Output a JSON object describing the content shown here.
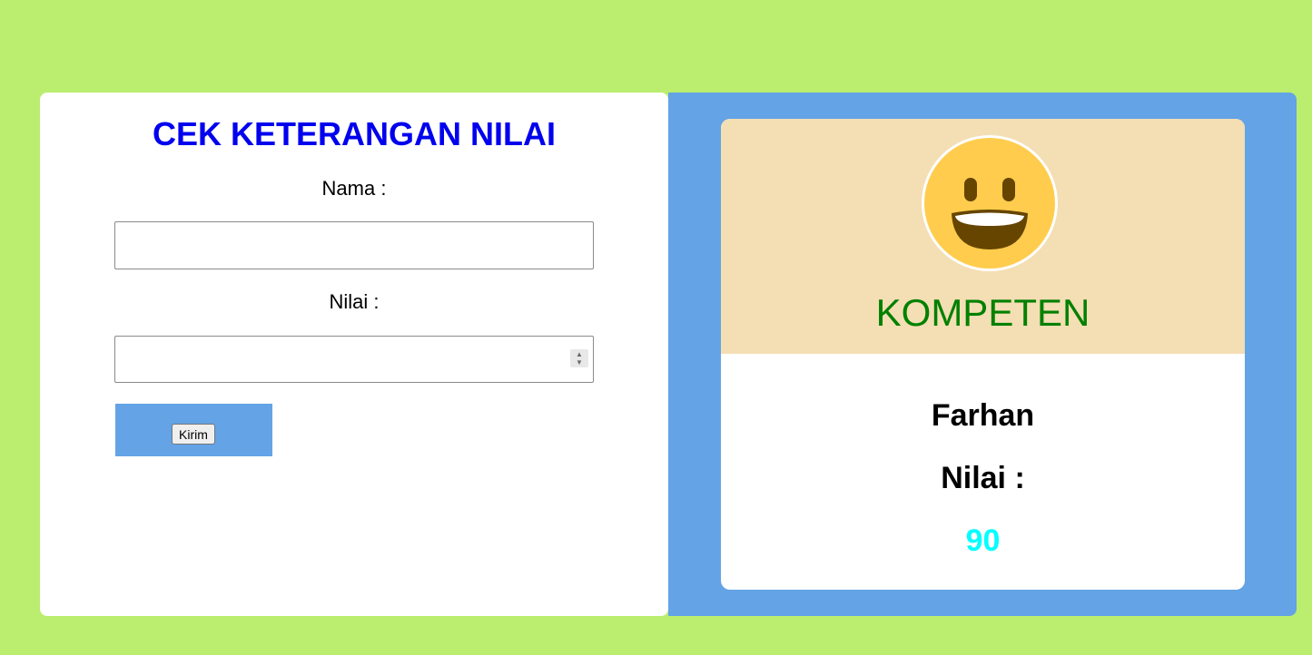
{
  "form": {
    "title": "CEK KETERANGAN NILAI",
    "name_label": "Nama :",
    "name_value": "",
    "score_label": "Nilai :",
    "score_value": "",
    "submit_label": "Kirim"
  },
  "result": {
    "status": "KOMPETEN",
    "name": "Farhan",
    "score_label": "Nilai :",
    "score": "90",
    "emoji_icon": "smiling-face-icon"
  },
  "colors": {
    "page_background": "#bbed6f",
    "title": "#0000ee",
    "panel_accent": "#63a3e6",
    "result_header": "#f4deb4",
    "status_text": "#008000",
    "score_text": "#00ffff",
    "emoji_face": "#ffcc4d"
  }
}
